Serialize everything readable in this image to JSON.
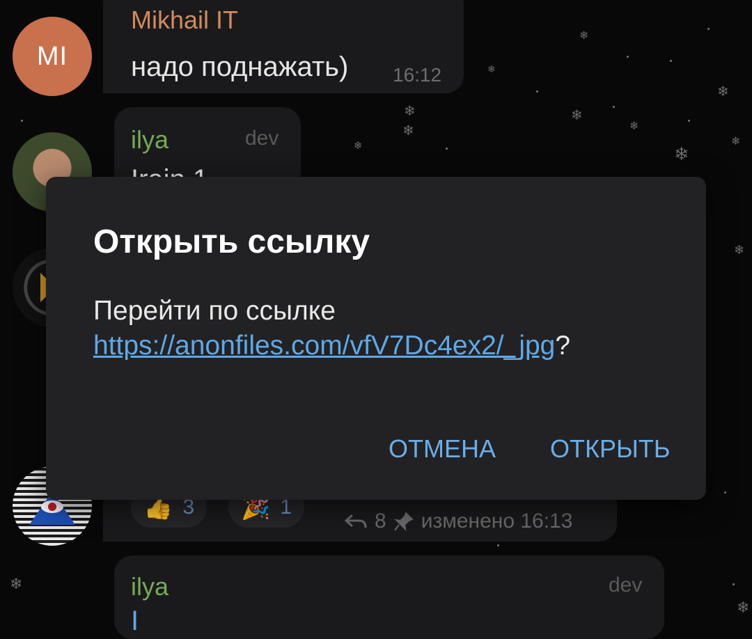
{
  "messages": [
    {
      "avatar_initials": "MI",
      "sender": "Mikhail IT",
      "text": "надо поднажать)",
      "time": "16:12"
    },
    {
      "sender": "ilya",
      "role": "dev",
      "text": "Irain 1"
    },
    {
      "reactions": [
        {
          "emoji": "👍",
          "count": "3"
        },
        {
          "emoji": "🎉",
          "count": "1"
        }
      ],
      "reply_count": "8",
      "edited_time": "изменено 16:13"
    },
    {
      "sender": "ilya",
      "role": "dev",
      "text": "I"
    }
  ],
  "dialog": {
    "title": "Открыть ссылку",
    "prompt": "Перейти по ссылке",
    "url": "https://anonfiles.com/vfV7Dc4ex2/_jpg",
    "suffix": "?",
    "cancel_label": "ОТМЕНА",
    "open_label": "ОТКРЫТЬ"
  },
  "icons": {
    "reply": "reply-arrow-icon",
    "pin": "pin-icon",
    "snow": "snowflake-icon"
  },
  "colors": {
    "link": "#5fa8e6",
    "button": "#6aaee8",
    "dialog_bg": "#222224",
    "sender_orange": "#d18a5c",
    "sender_green": "#76a957"
  }
}
